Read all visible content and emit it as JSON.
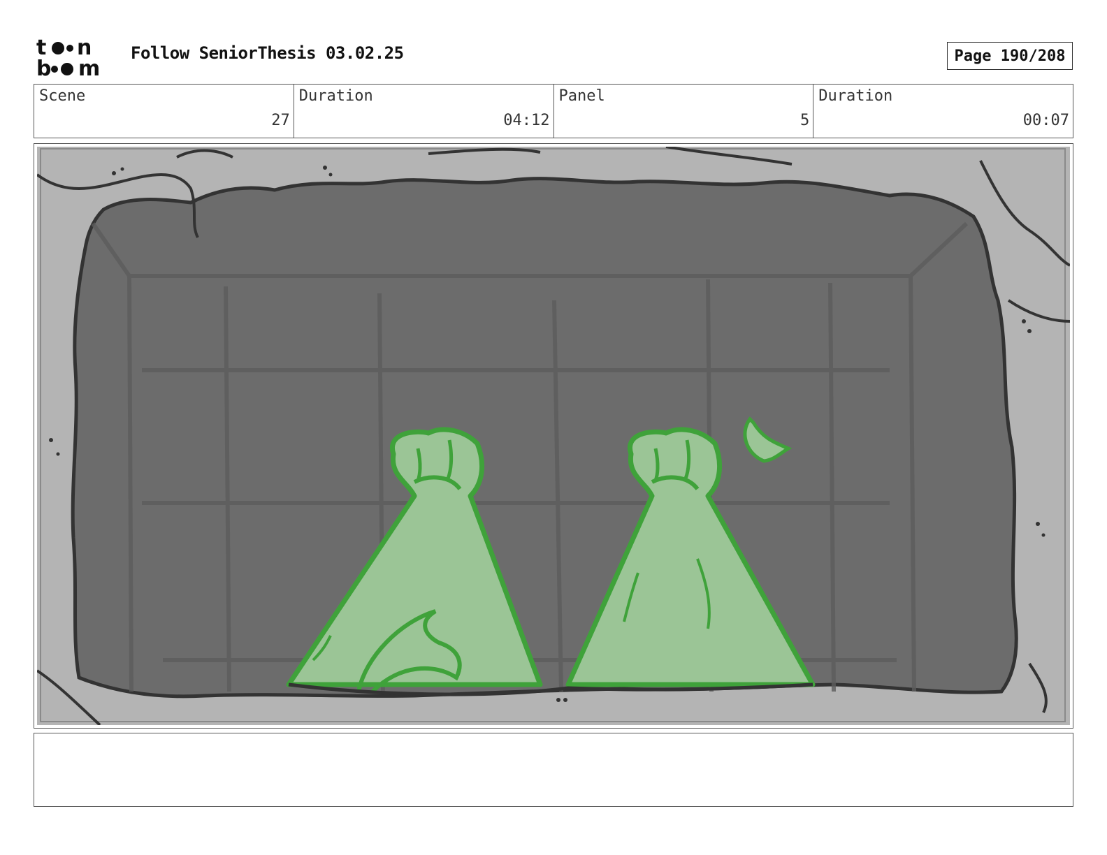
{
  "header": {
    "logo_text": "toon boom",
    "project_title": "Follow SeniorThesis 03.02.25",
    "page_label": "Page 190/208"
  },
  "info": {
    "scene_label": "Scene",
    "scene_value": "27",
    "scene_duration_label": "Duration",
    "scene_duration_value": "04:12",
    "panel_label": "Panel",
    "panel_value": "5",
    "panel_duration_label": "Duration",
    "panel_duration_value": "00:07"
  },
  "panel_image": {
    "description_icon": "cave-opening-with-two-green-creatures-sketch-icon"
  },
  "notes": {
    "text": ""
  }
}
